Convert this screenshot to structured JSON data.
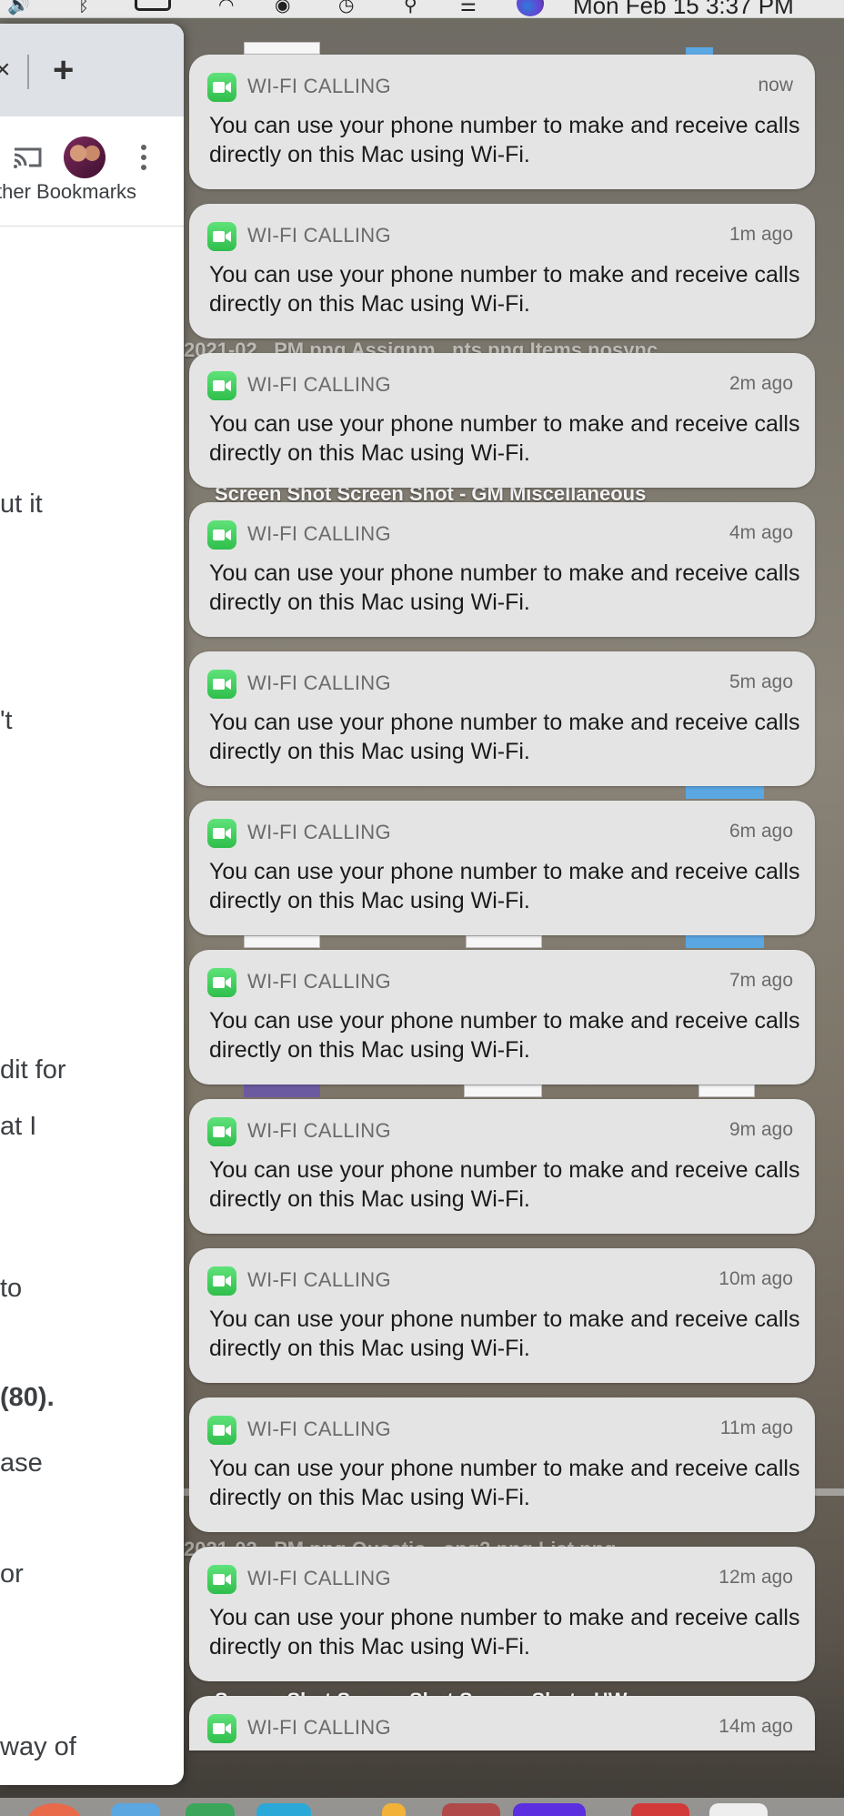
{
  "menubar": {
    "clock": "Mon Feb 15  3:37 PM"
  },
  "browser": {
    "new_tab_label": "+",
    "bookmarks_label": "ther Bookmarks",
    "page_fragments": [
      {
        "text": "ut it",
        "bold": false
      },
      {
        "text": "'t",
        "bold": false
      },
      {
        "text": "dit for",
        "bold": false
      },
      {
        "text": "at I",
        "bold": false
      },
      {
        "text": "to",
        "bold": false
      },
      {
        "text": "(80).",
        "bold": true
      },
      {
        "text": "ase",
        "bold": false
      },
      {
        "text": "or",
        "bold": false
      },
      {
        "text": "way of",
        "bold": false
      }
    ]
  },
  "desktop": {
    "labels": [
      "2021-02...PM.png   Assignm...nts.png   Items nosync",
      "Screen Shot        Screen Shot - GM        Miscellaneous",
      "2021-02...PM.png   Questio...ong2.png         List.png",
      "Screen Shot          Screen Shot          Screen Shot - HW"
    ]
  },
  "notifications": [
    {
      "app": "WI-FI CALLING",
      "time": "now",
      "body": "You can use your phone number to make and receive calls directly on this Mac using Wi-Fi."
    },
    {
      "app": "WI-FI CALLING",
      "time": "1m ago",
      "body": "You can use your phone number to make and receive calls directly on this Mac using Wi-Fi."
    },
    {
      "app": "WI-FI CALLING",
      "time": "2m ago",
      "body": "You can use your phone number to make and receive calls directly on this Mac using Wi-Fi."
    },
    {
      "app": "WI-FI CALLING",
      "time": "4m ago",
      "body": "You can use your phone number to make and receive calls directly on this Mac using Wi-Fi."
    },
    {
      "app": "WI-FI CALLING",
      "time": "5m ago",
      "body": "You can use your phone number to make and receive calls directly on this Mac using Wi-Fi."
    },
    {
      "app": "WI-FI CALLING",
      "time": "6m ago",
      "body": "You can use your phone number to make and receive calls directly on this Mac using Wi-Fi."
    },
    {
      "app": "WI-FI CALLING",
      "time": "7m ago",
      "body": "You can use your phone number to make and receive calls directly on this Mac using Wi-Fi."
    },
    {
      "app": "WI-FI CALLING",
      "time": "9m ago",
      "body": "You can use your phone number to make and receive calls directly on this Mac using Wi-Fi."
    },
    {
      "app": "WI-FI CALLING",
      "time": "10m ago",
      "body": "You can use your phone number to make and receive calls directly on this Mac using Wi-Fi."
    },
    {
      "app": "WI-FI CALLING",
      "time": "11m ago",
      "body": "You can use your phone number to make and receive calls directly on this Mac using Wi-Fi."
    },
    {
      "app": "WI-FI CALLING",
      "time": "12m ago",
      "body": "You can use your phone number to make and receive calls directly on this Mac using Wi-Fi."
    },
    {
      "app": "WI-FI CALLING",
      "time": "14m ago",
      "body": ""
    }
  ],
  "colors": {
    "app_icon_green": "#34c759",
    "notification_bg": "#e4e4e4"
  }
}
